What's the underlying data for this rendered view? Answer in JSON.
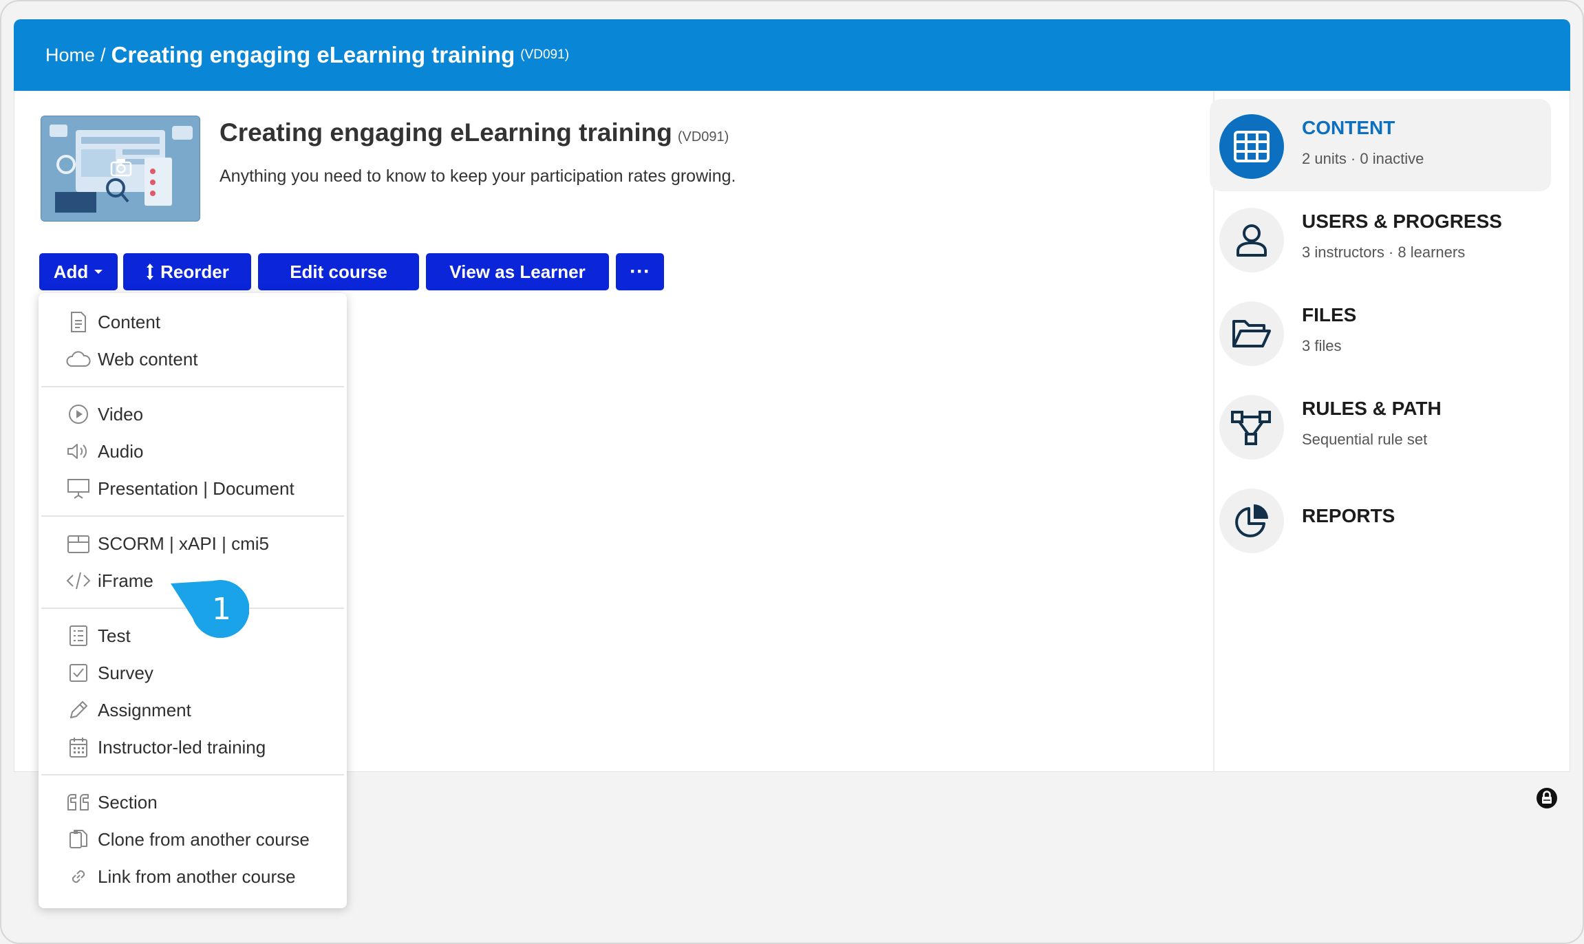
{
  "breadcrumb": {
    "home": "Home",
    "separator": "/",
    "title": "Creating engaging eLearning training",
    "code": "(VD091)"
  },
  "course": {
    "title": "Creating engaging eLearning training",
    "code": "(VD091)",
    "description": "Anything you need to know to keep your participation rates growing."
  },
  "toolbar": {
    "add": "Add",
    "reorder": "Reorder",
    "edit_course": "Edit course",
    "view_as_learner": "View as Learner",
    "more": "···"
  },
  "add_menu": {
    "items": [
      {
        "label": "Content",
        "icon": "document-icon"
      },
      {
        "label": "Web content",
        "icon": "cloud-icon"
      },
      {
        "label": "Video",
        "icon": "play-icon"
      },
      {
        "label": "Audio",
        "icon": "speaker-icon"
      },
      {
        "label": "Presentation | Document",
        "icon": "presentation-icon"
      },
      {
        "label": "SCORM | xAPI | cmi5",
        "icon": "package-icon"
      },
      {
        "label": "iFrame",
        "icon": "code-icon"
      },
      {
        "label": "Test",
        "icon": "checklist-icon"
      },
      {
        "label": "Survey",
        "icon": "checkbox-icon"
      },
      {
        "label": "Assignment",
        "icon": "pencil-icon"
      },
      {
        "label": "Instructor-led training",
        "icon": "calendar-icon"
      },
      {
        "label": "Section",
        "icon": "quote-icon"
      },
      {
        "label": "Clone from another course",
        "icon": "clone-icon"
      },
      {
        "label": "Link from another course",
        "icon": "link-icon"
      }
    ]
  },
  "callout": {
    "number": "1",
    "color": "#1aa3e8"
  },
  "sidebar": {
    "items": [
      {
        "title": "CONTENT",
        "subtitle": "2 units · 0 inactive",
        "icon": "grid-icon",
        "active": true
      },
      {
        "title": "USERS & PROGRESS",
        "subtitle": "3 instructors · 8 learners",
        "icon": "user-icon"
      },
      {
        "title": "FILES",
        "subtitle": "3 files",
        "icon": "folder-open-icon"
      },
      {
        "title": "RULES & PATH",
        "subtitle": "Sequential rule set",
        "icon": "flow-icon"
      },
      {
        "title": "REPORTS",
        "subtitle": "",
        "icon": "pie-chart-icon"
      }
    ]
  },
  "colors": {
    "header": "#0a86d6",
    "button": "#0b25d9",
    "active": "#0c6fc0"
  }
}
